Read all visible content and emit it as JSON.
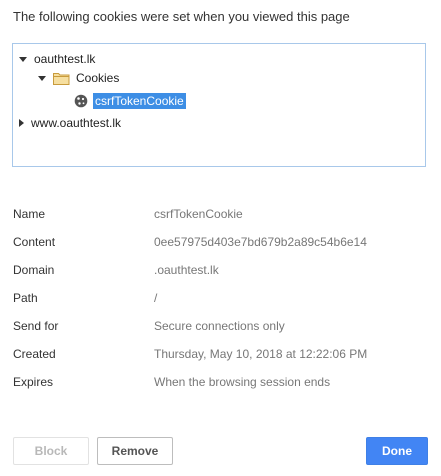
{
  "dialog": {
    "heading": "The following cookies were set when you viewed this page"
  },
  "tree": {
    "nodes": [
      {
        "label": "oauthtest.lk",
        "expanded": true,
        "icon": "none"
      },
      {
        "label": "Cookies",
        "expanded": true,
        "icon": "folder-icon"
      },
      {
        "label": "csrfTokenCookie",
        "selected": true,
        "icon": "cookie-icon"
      },
      {
        "label": "www.oauthtest.lk",
        "expanded": false,
        "icon": "none"
      }
    ]
  },
  "details": {
    "rows": [
      {
        "label": "Name",
        "value": "csrfTokenCookie"
      },
      {
        "label": "Content",
        "value": "0ee57975d403e7bd679b2a89c54b6e14"
      },
      {
        "label": "Domain",
        "value": ".oauthtest.lk"
      },
      {
        "label": "Path",
        "value": "/"
      },
      {
        "label": "Send for",
        "value": "Secure connections only"
      },
      {
        "label": "Created",
        "value": "Thursday, May 10, 2018 at 12:22:06 PM"
      },
      {
        "label": "Expires",
        "value": "When the browsing session ends"
      }
    ]
  },
  "buttons": {
    "block_label": "Block",
    "remove_label": "Remove",
    "done_label": "Done"
  },
  "colors": {
    "accent": "#4285f4",
    "selection": "#3d8ee5",
    "tree_border": "#a8c8ea"
  }
}
